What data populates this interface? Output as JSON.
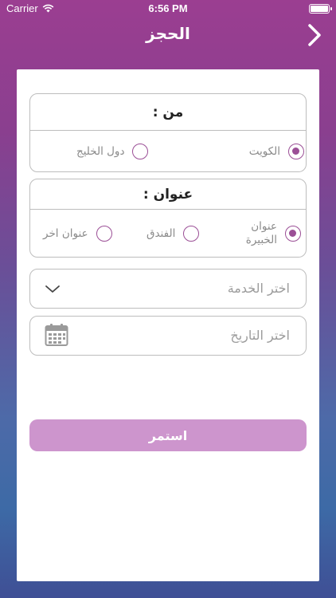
{
  "status_bar": {
    "carrier": "Carrier",
    "time": "6:56 PM"
  },
  "nav": {
    "title": "الحجز"
  },
  "from_group": {
    "heading": "من :",
    "options": [
      {
        "label": "الكويت",
        "selected": true
      },
      {
        "label": "دول الخليج",
        "selected": false
      }
    ]
  },
  "address_group": {
    "heading": "عنوان :",
    "options": [
      {
        "label": "عنوان الخبيرة",
        "selected": true
      },
      {
        "label": "الفندق",
        "selected": false
      },
      {
        "label": "عنوان اخر",
        "selected": false
      }
    ]
  },
  "service_field": {
    "placeholder": "اختر الخدمة"
  },
  "date_field": {
    "placeholder": "اختر التاريخ"
  },
  "submit": {
    "label": "استمر"
  },
  "colors": {
    "accent": "#9b4f96",
    "button": "#cd95cd",
    "border": "#bdbdbd"
  }
}
